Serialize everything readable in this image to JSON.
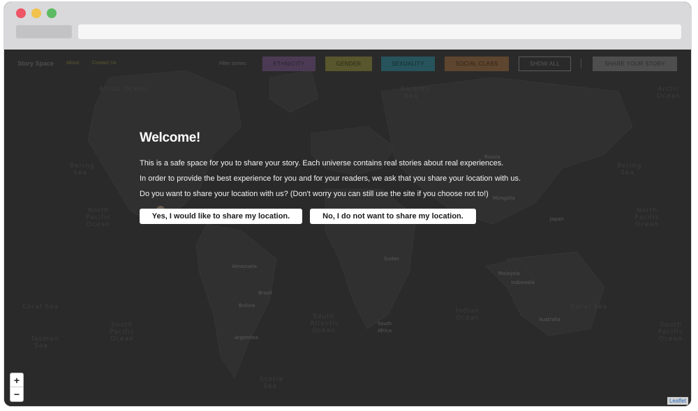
{
  "app": {
    "brand": "Story Space",
    "nav": {
      "about": "About",
      "contact": "Contact Us"
    }
  },
  "filters": {
    "label": "Filter stories:",
    "items": [
      {
        "key": "ethnicity",
        "label": "ETHNICITY",
        "color": "#4c3a55"
      },
      {
        "key": "gender",
        "label": "GENDER",
        "color": "#57562c"
      },
      {
        "key": "sexuality",
        "label": "SEXUALITY",
        "color": "#26535c"
      },
      {
        "key": "socialclass",
        "label": "SOCIAL CLASS",
        "color": "#5e452f"
      }
    ],
    "show_all": "SHOW ALL",
    "separator": "|",
    "share": "SHARE YOUR STORY"
  },
  "modal": {
    "title": "Welcome!",
    "paragraphs": [
      "This is a safe space for you to share your story. Each universe contains real stories about real experiences.",
      "In order to provide the best experience for you and for your readers, we ask that you share your location with us.",
      "Do you want to share your location with us? (Don't worry you can still use the site if you choose not to!)"
    ],
    "yes_button": "Yes, I would like to share my location.",
    "no_button": "No, I do not want to share my location."
  },
  "map": {
    "labels": {
      "arctic_ocean_left": "Arctic Ocean",
      "arctic_ocean_right": "Arctic Ocean",
      "barents_sea": "Barents Sea",
      "bering_sea_left": "Bering Sea",
      "bering_sea_right": "Bering Sea",
      "north_pacific_left": "North Pacific Ocean",
      "north_pacific_right": "North Pacific Ocean",
      "south_pacific_left": "South Pacific Ocean",
      "south_pacific_right": "South Pacific Ocean",
      "south_atlantic": "South Atlantic Ocean",
      "indian_ocean": "Indian Ocean",
      "coral_sea_left": "Coral Sea",
      "coral_sea_right": "Coral Sea",
      "tasman_sea": "Tasman Sea",
      "scotia_sea": "Scotia Sea",
      "russia": "Russia",
      "mongolia": "Mongolia",
      "japan": "Japan",
      "venezuela": "Venezuela",
      "brazil": "Brazil",
      "bolivia": "Bolivia",
      "argentina": "Argentina",
      "sudan": "Sudan",
      "south_africa": "South Africa",
      "malaysia": "Malaysia",
      "indonesia": "Indonesia",
      "australia": "Australia"
    },
    "zoom_in": "+",
    "zoom_out": "−",
    "attribution": "Leaflet"
  }
}
